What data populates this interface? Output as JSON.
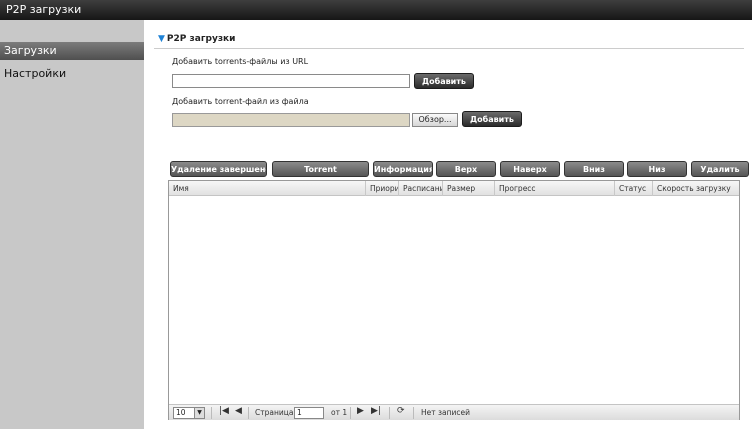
{
  "app": {
    "title": "P2P загрузки"
  },
  "sidebar": {
    "items": [
      {
        "label": "Загрузки",
        "active": true
      },
      {
        "label": "Настройки",
        "active": false
      }
    ]
  },
  "section": {
    "title": "P2P загрузки",
    "url_label": "Добавить torrents-файлы из URL",
    "url_value": "",
    "add_label": "Добавить",
    "file_label": "Добавить torrent-файл из файла",
    "file_value": "",
    "browse_label": "Обзор...",
    "add_file_label": "Добавить"
  },
  "toolbar": {
    "buttons": [
      "Удаление завершено",
      "Torrent",
      "Информация",
      "Верх",
      "Наверх",
      "Вниз",
      "Низ",
      "Удалить"
    ]
  },
  "table": {
    "columns": [
      "Имя",
      "Приори",
      "Расписани",
      "Размер",
      "Прогресс",
      "Статус",
      "Скорость загрузку"
    ],
    "rows": []
  },
  "pager": {
    "page_size": "10",
    "page_label": "Страница",
    "page_value": "1",
    "of_label": "от 1",
    "status": "Нет записей",
    "first_icon": "first-page-icon",
    "prev_icon": "prev-page-icon",
    "next_icon": "next-page-icon",
    "last_icon": "last-page-icon",
    "refresh_icon": "refresh-icon"
  },
  "colors": {
    "accent": "#1e82d6",
    "titlebar": "#1c1c1c",
    "sidebar": "#c8c8c8"
  }
}
